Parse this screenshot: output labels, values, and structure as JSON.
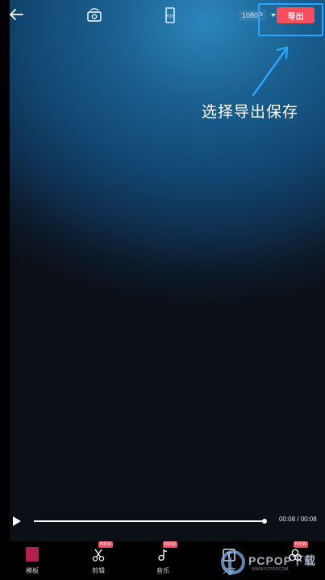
{
  "topbar": {
    "resolution": "1080P",
    "export_label": "导出"
  },
  "annotation": {
    "text": "选择导出保存",
    "arrow_color": "#2aa6ff",
    "box_color": "#2aa6ff"
  },
  "player": {
    "time": "00:08 / 00:08",
    "progress": 1.0
  },
  "tools": [
    {
      "label": "模板",
      "icon": "template-thumbnail",
      "badge": ""
    },
    {
      "label": "剪辑",
      "icon": "scissors-icon",
      "badge": "NEW"
    },
    {
      "label": "音乐",
      "icon": "music-note-icon",
      "badge": "NEW"
    },
    {
      "label": "文字",
      "icon": "text-icon",
      "badge": ""
    },
    {
      "label": "",
      "icon": "effects-icon",
      "badge": "NEW"
    }
  ],
  "watermark": {
    "text": "PCPOP下载",
    "sub": "WWW.PCPOP.COM"
  },
  "colors": {
    "accent": "#fb4d5b",
    "highlight": "#2aa6ff"
  }
}
